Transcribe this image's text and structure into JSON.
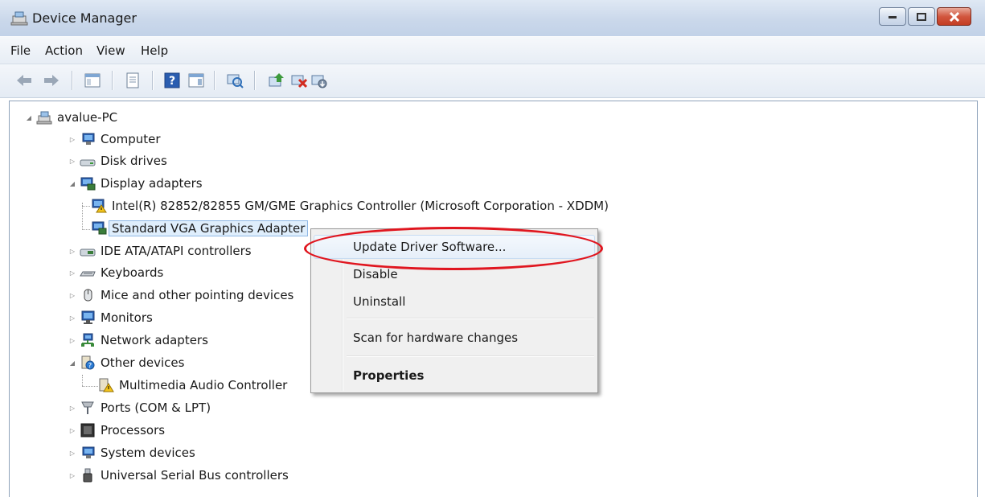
{
  "window": {
    "title": "Device Manager",
    "title_icon": "device-manager-icon"
  },
  "menubar": {
    "items": [
      "File",
      "Action",
      "View",
      "Help"
    ]
  },
  "toolbar": {
    "buttons": [
      "back-icon",
      "forward-icon",
      "show-hide-console-tree-icon",
      "properties-icon",
      "help-icon",
      "action-pane-icon",
      "scan-hardware-icon",
      "update-driver-icon",
      "uninstall-icon",
      "disable-icon"
    ]
  },
  "tree": {
    "root": "avalue-PC",
    "items": [
      {
        "label": "Computer",
        "icon": "computer-icon",
        "expanded": false
      },
      {
        "label": "Disk drives",
        "icon": "disk-drive-icon",
        "expanded": false
      },
      {
        "label": "Display adapters",
        "icon": "display-adapter-icon",
        "expanded": true,
        "children": [
          {
            "label": "Intel(R) 82852/82855 GM/GME Graphics Controller (Microsoft Corporation - XDDM)",
            "icon": "display-adapter-warning-icon"
          },
          {
            "label": "Standard VGA Graphics Adapter",
            "icon": "display-adapter-icon",
            "selected": true
          }
        ]
      },
      {
        "label": "IDE ATA/ATAPI controllers",
        "icon": "ide-controller-icon",
        "expanded": false
      },
      {
        "label": "Keyboards",
        "icon": "keyboard-icon",
        "expanded": false
      },
      {
        "label": "Mice and other pointing devices",
        "icon": "mouse-icon",
        "expanded": false
      },
      {
        "label": "Monitors",
        "icon": "monitor-icon",
        "expanded": false
      },
      {
        "label": "Network adapters",
        "icon": "network-adapter-icon",
        "expanded": false
      },
      {
        "label": "Other devices",
        "icon": "other-devices-icon",
        "expanded": true,
        "children": [
          {
            "label": "Multimedia Audio Controller",
            "icon": "unknown-device-warning-icon"
          }
        ]
      },
      {
        "label": "Ports (COM & LPT)",
        "icon": "port-icon",
        "expanded": false
      },
      {
        "label": "Processors",
        "icon": "processor-icon",
        "expanded": false
      },
      {
        "label": "System devices",
        "icon": "system-device-icon",
        "expanded": false
      },
      {
        "label": "Universal Serial Bus controllers",
        "icon": "usb-icon",
        "expanded": false
      }
    ]
  },
  "context_menu": {
    "items": [
      {
        "label": "Update Driver Software...",
        "highlighted": true
      },
      {
        "label": "Disable"
      },
      {
        "label": "Uninstall"
      },
      {
        "label": "Scan for hardware changes"
      },
      {
        "label": "Properties",
        "bold": true
      }
    ]
  },
  "annotation": {
    "color": "#e0161f"
  }
}
